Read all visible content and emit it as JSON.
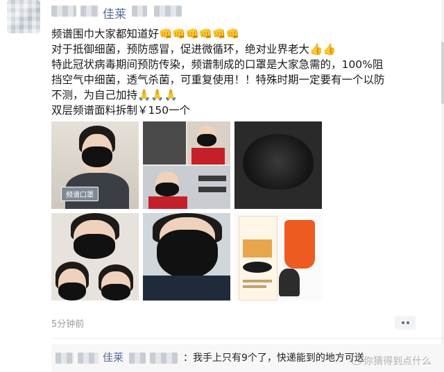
{
  "header": {
    "name": "佳莱"
  },
  "post": {
    "lines": [
      "频谱围巾大家都知道好👊👊👊👊👊👊",
      "对于抵御细菌，预防感冒，促进微循环，绝对业界老大👍👍",
      "特此冠状病毒期间预防传染，频谱制成的口罩是大家急需的，100%阻",
      "挡空气中细菌，透气杀菌，可重复使用！！特殊时期一定要有一个以防",
      "不测，为自己加持🙏🙏🙏",
      "双层频谱面料拆制￥150一个"
    ],
    "photo_tag": "频谱口罩",
    "time": "5分钟前",
    "more_icon": "more-dots-icon"
  },
  "comment": {
    "name": "佳莱",
    "text": "：我手上只有9个了，快递能到的地方可送"
  },
  "watermark": "你猜得到点什么",
  "colors": {
    "link": "#576b95",
    "time": "#9a9a9a",
    "comment_bg": "#f7f7f7"
  }
}
